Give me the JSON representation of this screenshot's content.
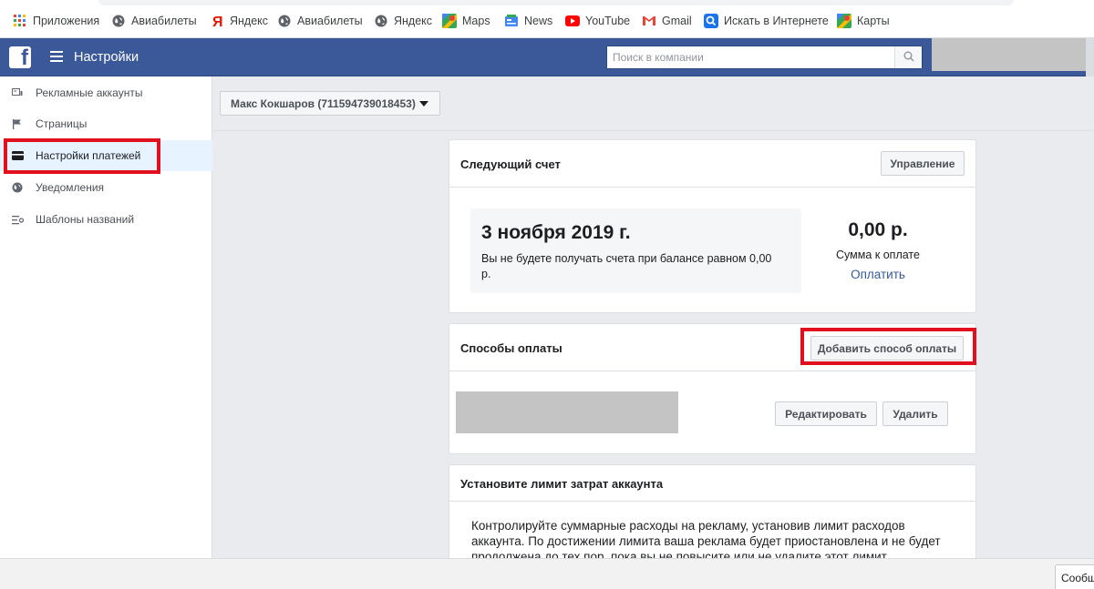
{
  "browser": {
    "bookmarks": [
      {
        "label": "Приложения",
        "icon": "apps-grid-icon"
      },
      {
        "label": "Авиабилеты",
        "icon": "globe-icon"
      },
      {
        "label": "Яндекс",
        "icon": "yandex-icon"
      },
      {
        "label": "Авиабилеты",
        "icon": "globe-icon"
      },
      {
        "label": "Яндекс",
        "icon": "globe-icon"
      },
      {
        "label": "Maps",
        "icon": "maps-icon"
      },
      {
        "label": "News",
        "icon": "news-icon"
      },
      {
        "label": "YouTube",
        "icon": "youtube-icon"
      },
      {
        "label": "Gmail",
        "icon": "gmail-icon"
      },
      {
        "label": "Искать в Интернете",
        "icon": "search-web-icon"
      },
      {
        "label": "Карты",
        "icon": "maps-icon"
      }
    ]
  },
  "topbar": {
    "title": "Настройки",
    "search_placeholder": "Поиск в компании",
    "brand_color": "#3b5998"
  },
  "sidebar": {
    "items": [
      {
        "label": "Рекламные аккаунты",
        "icon": "ad-accounts-icon"
      },
      {
        "label": "Страницы",
        "icon": "flag-icon"
      },
      {
        "label": "Настройки платежей",
        "icon": "credit-card-icon",
        "active": true
      },
      {
        "label": "Уведомления",
        "icon": "globe-icon"
      },
      {
        "label": "Шаблоны названий",
        "icon": "list-settings-icon"
      }
    ]
  },
  "account_selector": {
    "label": "Макс Кокшаров (711594739018453)"
  },
  "next_invoice": {
    "title": "Следующий счет",
    "manage_button": "Управление",
    "date": "3 ноября 2019 г.",
    "note": "Вы не будете получать счета при балансе равном 0,00 р.",
    "amount": "0,00 р.",
    "amount_label": "Сумма к оплате",
    "pay_link": "Оплатить"
  },
  "payment_methods": {
    "title": "Способы оплаты",
    "add_button": "Добавить способ оплаты",
    "edit_button": "Редактировать",
    "delete_button": "Удалить"
  },
  "spend_limit": {
    "title": "Установите лимит затрат аккаунта",
    "text": "Контролируйте суммарные расходы на рекламу, установив лимит расходов аккаунта. По достижении лимита ваша реклама будет приостановлена и не будет продолжена до тех пор, пока вы не повысите или не удалите этот лимит."
  },
  "chat": {
    "label": "Сообщ"
  },
  "highlight_color": "#e0101f"
}
